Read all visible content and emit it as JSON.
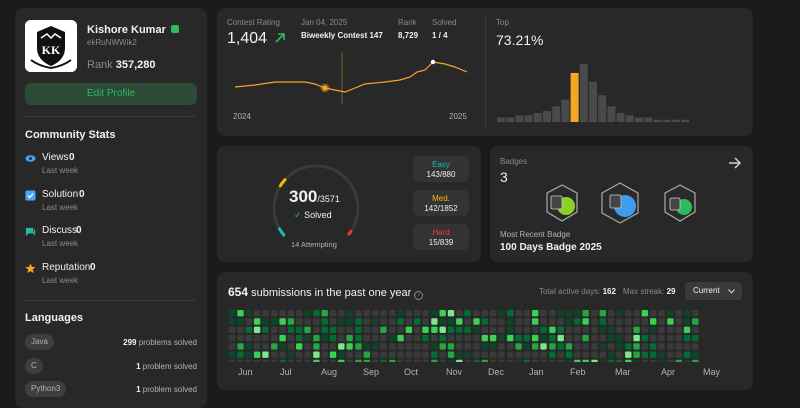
{
  "profile": {
    "name": "Kishore Kumar",
    "username": "ekRuNWWik2",
    "rank_label": "Rank",
    "rank_value": "357,280",
    "edit_label": "Edit Profile",
    "avatar_text": "KK"
  },
  "community": {
    "title": "Community Stats",
    "stats": [
      {
        "label": "Views",
        "value": "0",
        "sub": "Last week",
        "color": "#49a6f5"
      },
      {
        "label": "Solution",
        "value": "0",
        "sub": "Last week",
        "color": "#49a6f5"
      },
      {
        "label": "Discuss",
        "value": "0",
        "sub": "Last week",
        "color": "#2cb9a2"
      },
      {
        "label": "Reputation",
        "value": "0",
        "sub": "Last week",
        "color": "#f5a623"
      }
    ]
  },
  "languages": {
    "title": "Languages",
    "items": [
      {
        "name": "Java",
        "count": "299",
        "suffix": "problems solved"
      },
      {
        "name": "C",
        "count": "1",
        "suffix": "problem solved"
      },
      {
        "name": "Python3",
        "count": "1",
        "suffix": "problem solved"
      }
    ]
  },
  "contest": {
    "rating_label": "Contest Rating",
    "rating_value": "1,404",
    "date": "Jan 04, 2025",
    "contest_name": "Biweekly Contest 147",
    "rank_label": "Rank",
    "rank_value": "8,729",
    "solved_label": "Solved",
    "solved_value": "1 / 4",
    "year_start": "2024",
    "year_end": "2025",
    "top_label": "Top",
    "top_value": "73.21%",
    "accent": "#f5a623"
  },
  "rating_chart": {
    "line": [
      [
        0,
        35
      ],
      [
        20,
        33
      ],
      [
        40,
        30
      ],
      [
        60,
        30
      ],
      [
        70,
        30
      ],
      [
        80,
        32
      ],
      [
        90,
        36
      ],
      [
        100,
        38
      ],
      [
        110,
        40
      ],
      [
        120,
        36
      ],
      [
        130,
        32
      ],
      [
        150,
        30
      ],
      [
        165,
        28
      ],
      [
        175,
        25
      ],
      [
        182,
        20
      ],
      [
        190,
        18
      ],
      [
        198,
        10
      ],
      [
        210,
        12
      ],
      [
        220,
        15
      ],
      [
        232,
        20
      ]
    ],
    "current_index": 6
  },
  "histogram": {
    "bars": [
      2,
      2,
      3,
      3,
      4,
      5,
      7,
      10,
      22,
      26,
      18,
      12,
      7,
      4,
      3,
      2,
      2,
      1,
      1,
      1,
      1
    ],
    "highlight_index": 8
  },
  "solved": {
    "solved": "300",
    "total": "/3571",
    "solved_label": "Solved",
    "attempting": "14 Attempting",
    "easy_label": "Easy",
    "easy_value": "143/880",
    "easy_color": "#1cbaba",
    "medium_label": "Med.",
    "medium_value": "142/1852",
    "medium_color": "#ffb700",
    "hard_label": "Hard",
    "hard_value": "15/839",
    "hard_color": "#f63737"
  },
  "badges": {
    "title": "Badges",
    "count": "3",
    "recent_label": "Most Recent Badge",
    "recent_name": "100 Days Badge 2025"
  },
  "submissions": {
    "count": "654",
    "text": "submissions in the past one year",
    "active_label": "Total active days:",
    "active_value": "162",
    "streak_label": "Max streak:",
    "streak_value": "29",
    "dropdown": "Current",
    "months": [
      "Jun",
      "Jul",
      "Aug",
      "Sep",
      "Oct",
      "Nov",
      "Dec",
      "Jan",
      "Feb",
      "Mar",
      "Apr",
      "May"
    ]
  }
}
